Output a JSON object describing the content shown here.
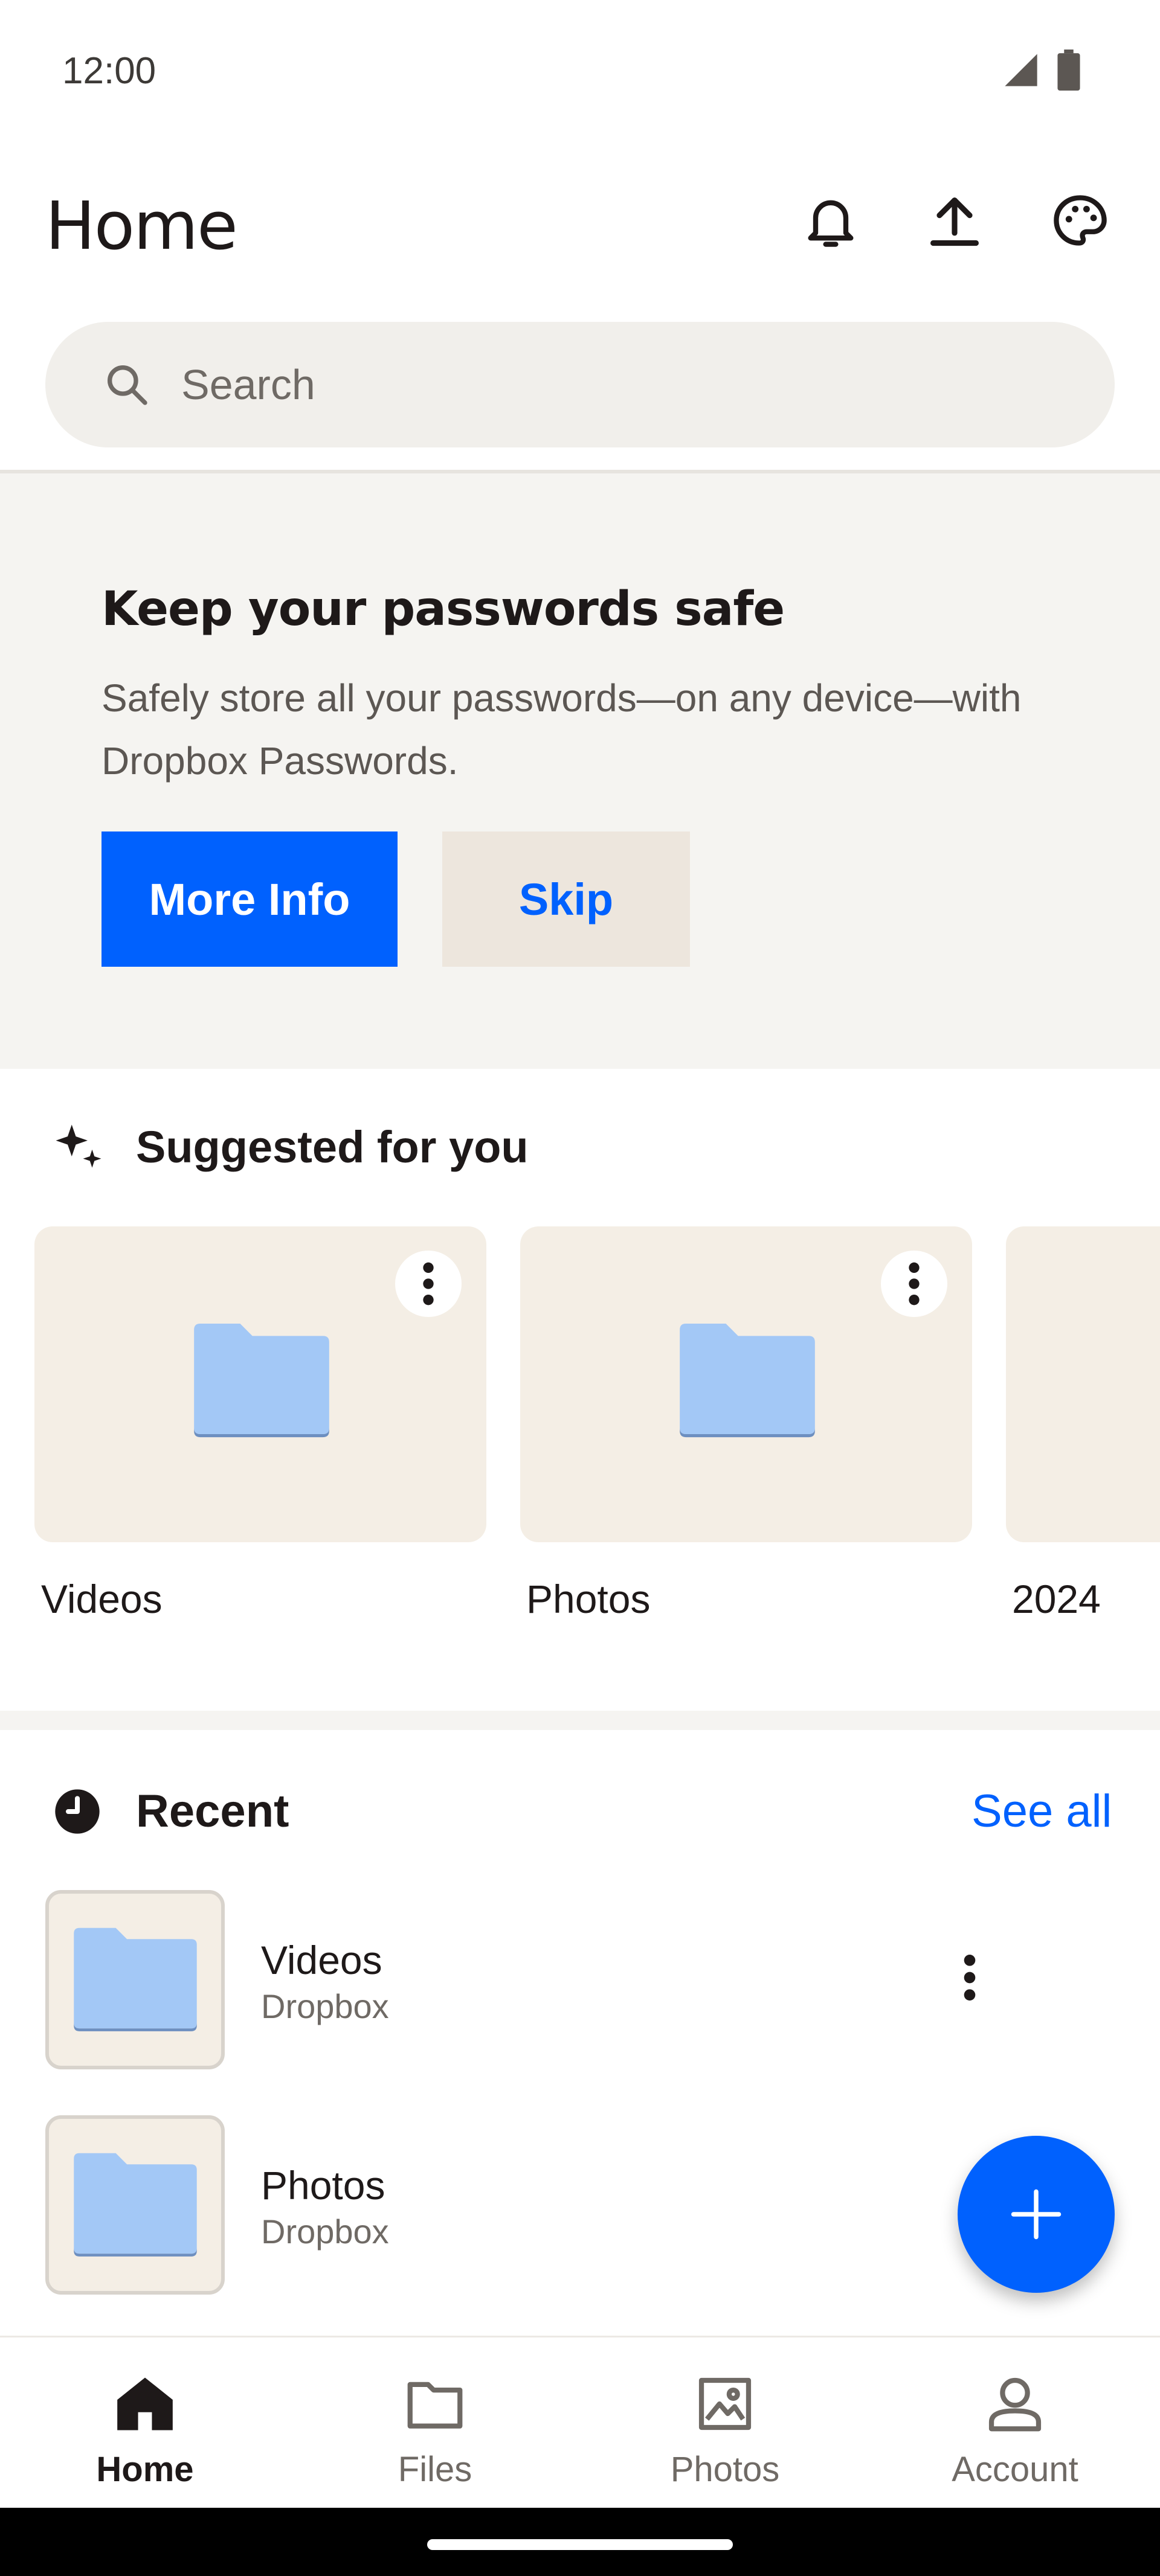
{
  "status_bar": {
    "time": "12:00"
  },
  "header": {
    "title": "Home"
  },
  "search": {
    "placeholder": "Search"
  },
  "promo": {
    "title": "Keep your passwords safe",
    "body": "Safely store all your passwords—on any device—with Dropbox Passwords.",
    "primary_label": "More Info",
    "secondary_label": "Skip"
  },
  "suggested": {
    "title": "Suggested for you",
    "items": [
      {
        "label": "Videos"
      },
      {
        "label": "Photos"
      },
      {
        "label": "2024"
      }
    ]
  },
  "recent": {
    "title": "Recent",
    "see_all": "See all",
    "items": [
      {
        "name": "Videos",
        "location": "Dropbox"
      },
      {
        "name": "Photos",
        "location": "Dropbox"
      }
    ]
  },
  "bottom_nav": {
    "items": [
      {
        "label": "Home",
        "icon": "home-icon",
        "active": true
      },
      {
        "label": "Files",
        "icon": "folder-icon",
        "active": false
      },
      {
        "label": "Photos",
        "icon": "image-icon",
        "active": false
      },
      {
        "label": "Account",
        "icon": "person-icon",
        "active": false
      }
    ]
  },
  "colors": {
    "accent": "#0061fe",
    "folder": "#a3c8f6",
    "card_bg": "#f4eee5",
    "promo_bg": "#f5f4f1"
  }
}
